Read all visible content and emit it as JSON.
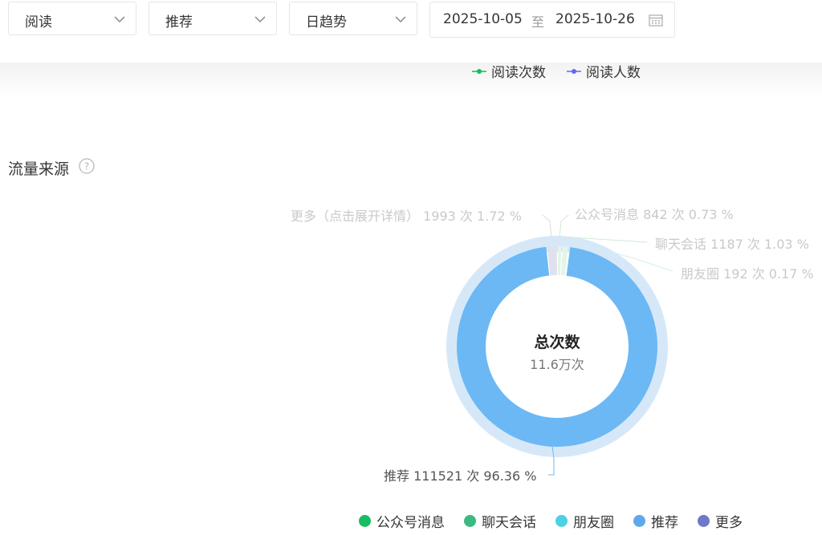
{
  "filters": {
    "metric": "阅读",
    "source": "推荐",
    "trend": "日趋势",
    "date_start": "2025-10-05",
    "date_sep": "至",
    "date_end": "2025-10-26"
  },
  "top_legend": [
    {
      "label": "阅读次数",
      "color": "#07c160"
    },
    {
      "label": "阅读人数",
      "color": "#6467f0"
    }
  ],
  "section": {
    "title": "流量来源",
    "help_icon": "question-circle-icon"
  },
  "donut": {
    "center_title": "总次数",
    "center_value": "11.6万次"
  },
  "slice_labels": {
    "more": "更多（点击展开详情） 1993 次 1.72 %",
    "official": "公众号消息 842 次 0.73 %",
    "chat": "聊天会话 1187 次 1.03 %",
    "moments": "朋友圈 192 次 0.17 %",
    "recommend": "推荐 111521 次 96.36 %"
  },
  "chart_data": {
    "type": "pie",
    "title": "流量来源",
    "center_label": "总次数",
    "center_value": "11.6万次",
    "slices": [
      {
        "name": "公众号消息",
        "value": 842,
        "percent": 0.73,
        "color": "#07c160"
      },
      {
        "name": "聊天会话",
        "value": 1187,
        "percent": 1.03,
        "color": "#3cb97f"
      },
      {
        "name": "朋友圈",
        "value": 192,
        "percent": 0.17,
        "color": "#4dd0e1"
      },
      {
        "name": "推荐",
        "value": 111521,
        "percent": 96.36,
        "color": "#6bb8f5"
      },
      {
        "name": "更多",
        "value": 1993,
        "percent": 1.72,
        "color": "#c7cbe8"
      }
    ],
    "legend_placement": "bottom"
  },
  "bottom_legend": [
    {
      "label": "公众号消息",
      "color": "#1abc62"
    },
    {
      "label": "聊天会话",
      "color": "#3cb97f"
    },
    {
      "label": "朋友圈",
      "color": "#4dd0e1"
    },
    {
      "label": "推荐",
      "color": "#5fa8ea"
    },
    {
      "label": "更多",
      "color": "#6f78c8"
    }
  ]
}
